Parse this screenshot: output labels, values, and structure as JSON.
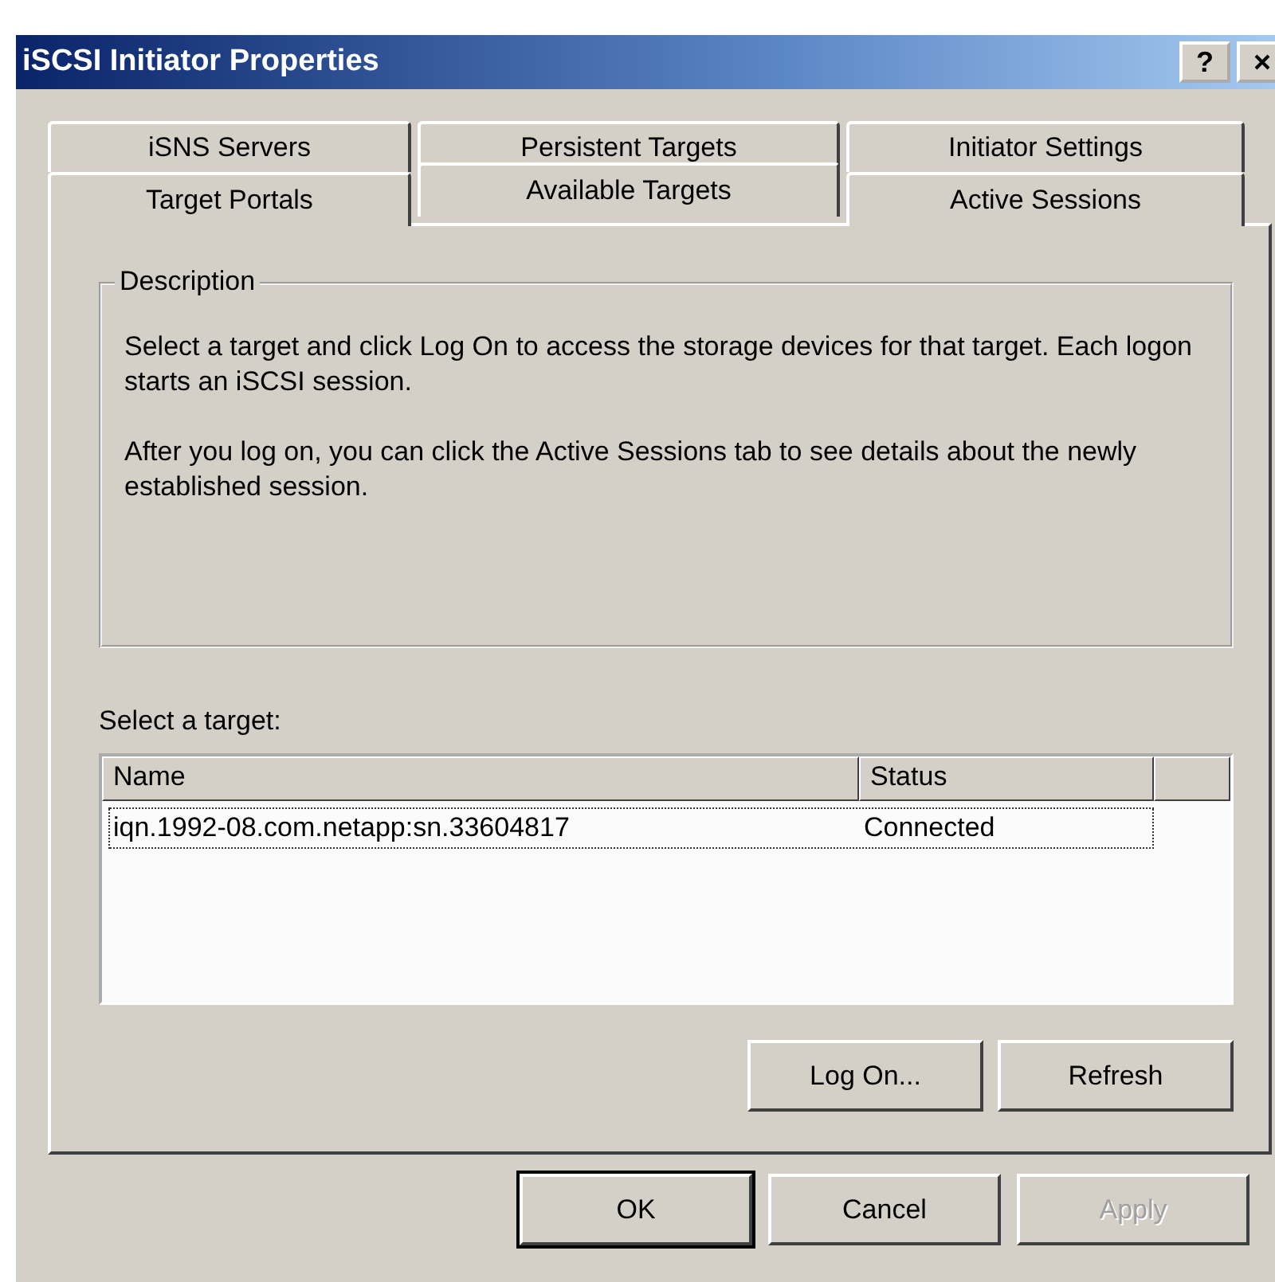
{
  "window": {
    "title": "iSCSI Initiator Properties",
    "help": "?"
  },
  "tab_rows": [
    [
      {
        "label": "iSNS Servers",
        "selected": false
      },
      {
        "label": "Persistent Targets",
        "selected": false
      },
      {
        "label": "Initiator Settings",
        "selected": false
      }
    ],
    [
      {
        "label": "Target Portals",
        "selected": false
      },
      {
        "label": "Available Targets",
        "selected": true
      },
      {
        "label": "Active Sessions",
        "selected": false
      }
    ]
  ],
  "description": {
    "legend": "Description",
    "paragraphs": [
      "Select a target and click Log On to access the storage devices for that target. Each logon starts an iSCSI session.",
      "After you log on, you can click the Active Sessions tab to see details about the newly established session."
    ]
  },
  "targets": {
    "label": "Select a target:",
    "columns": [
      "Name",
      "Status"
    ],
    "rows": [
      {
        "cells": [
          "iqn.1992-08.com.netapp:sn.33604817",
          "Connected"
        ],
        "focused": true
      }
    ]
  },
  "panel_buttons": [
    {
      "label": "Log On...",
      "disabled": false
    },
    {
      "label": "Refresh",
      "disabled": false
    }
  ],
  "dialog_buttons": [
    {
      "label": "OK",
      "default": true,
      "disabled": false
    },
    {
      "label": "Cancel",
      "default": false,
      "disabled": false
    },
    {
      "label": "Apply",
      "default": false,
      "disabled": true
    }
  ]
}
